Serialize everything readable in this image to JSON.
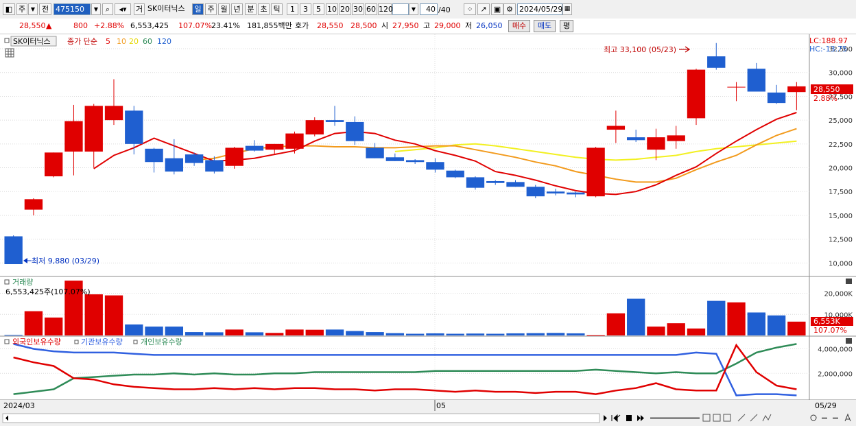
{
  "toolbar": {
    "type_label": "주",
    "prev_label": "전",
    "code": "475150",
    "name_btn": "거",
    "stock_name": "SK이터닉스",
    "periods": [
      "일",
      "주",
      "월",
      "년",
      "분",
      "초",
      "틱"
    ],
    "active_period": "일",
    "intervals": [
      "1",
      "3",
      "5",
      "10",
      "20",
      "30",
      "60",
      "120"
    ],
    "count": "40",
    "count_total": "/40",
    "date": "2024/05/29"
  },
  "quote": {
    "price": "28,550",
    "arrow": "▲",
    "change": "800",
    "change_pct": "+2.88%",
    "volume": "6,553,425",
    "vol_ratio": "107.07%",
    "turnover": "23.41%",
    "amount": "181,855백만",
    "bid_label": "호가",
    "ask": "28,550",
    "bid": "28,500",
    "open_label": "시",
    "open": "27,950",
    "high_label": "고",
    "high": "29,000",
    "low_label": "저",
    "low": "26,050",
    "buy_btn": "매수",
    "sell_btn": "매도",
    "eval_btn": "평"
  },
  "main_panel": {
    "name": "SK이터닉스",
    "ma_title": "종가 단순",
    "ma_periods": [
      "5",
      "10",
      "20",
      "60",
      "120"
    ],
    "lc": "LC:188.97",
    "hc": "HC:-13.75",
    "high_note": "최고 33,100 (05/23)",
    "low_note": "최저 9,880 (03/29)",
    "last_price_tag": "28,550",
    "last_pct_tag": "2.88%",
    "y_ticks": [
      "32,500",
      "30,000",
      "27,500",
      "25,000",
      "22,500",
      "20,000",
      "17,500",
      "15,000",
      "12,500",
      "10,000"
    ]
  },
  "volume_panel": {
    "title": "거래량",
    "value": "6,553,425주(107.07%)",
    "y_ticks": [
      "20,000K",
      "10,000K"
    ],
    "last_tag": "6,553K",
    "last_pct": "107.07%"
  },
  "holding_panel": {
    "legend": [
      "외국인보유수량",
      "기관보유수량",
      "개인보유수량"
    ],
    "y_ticks": [
      "4,000,000",
      "2,000,000"
    ]
  },
  "x_axis": {
    "labels": [
      "2024/03",
      "05",
      "05/29"
    ]
  },
  "colors": {
    "up": "#e00000",
    "down": "#1f5fd0",
    "ma5": "#e00000",
    "ma10": "#f29a1c",
    "ma20": "#f2f020",
    "foreign": "#e00000",
    "institution": "#3060e0",
    "individual": "#2e8b57"
  },
  "chart_data": {
    "type": "candlestick",
    "dates": [
      "03/29",
      "04/01",
      "04/02",
      "04/03",
      "04/04",
      "04/05",
      "04/08",
      "04/09",
      "04/11",
      "04/12",
      "04/15",
      "04/16",
      "04/17",
      "04/18",
      "04/19",
      "04/22",
      "04/23",
      "04/24",
      "04/25",
      "04/26",
      "04/29",
      "04/30",
      "05/02",
      "05/03",
      "05/07",
      "05/08",
      "05/09",
      "05/10",
      "05/13",
      "05/14",
      "05/16",
      "05/17",
      "05/20",
      "05/21",
      "05/22",
      "05/23",
      "05/24",
      "05/27",
      "05/28",
      "05/29"
    ],
    "ohlc": [
      [
        12800,
        12900,
        9880,
        9880
      ],
      [
        15600,
        16800,
        15000,
        16700
      ],
      [
        19100,
        21600,
        19000,
        21600
      ],
      [
        21700,
        26600,
        19200,
        24900
      ],
      [
        21700,
        26700,
        20000,
        26500
      ],
      [
        25000,
        29300,
        24500,
        26500
      ],
      [
        26000,
        26500,
        21400,
        22500
      ],
      [
        22000,
        22100,
        19500,
        20600
      ],
      [
        21000,
        23000,
        19300,
        19600
      ],
      [
        21400,
        21600,
        20200,
        20500
      ],
      [
        20800,
        21200,
        19400,
        19600
      ],
      [
        20200,
        22200,
        19900,
        22100
      ],
      [
        22300,
        22900,
        21700,
        21800
      ],
      [
        21900,
        22500,
        21400,
        22500
      ],
      [
        22000,
        23800,
        21500,
        23600
      ],
      [
        23500,
        25300,
        23300,
        25000
      ],
      [
        25000,
        26500,
        24400,
        24800
      ],
      [
        24800,
        25400,
        22400,
        22800
      ],
      [
        22100,
        22600,
        21000,
        21000
      ],
      [
        21100,
        21500,
        20700,
        20700
      ],
      [
        20800,
        20900,
        20400,
        20600
      ],
      [
        20600,
        21000,
        19500,
        19800
      ],
      [
        19700,
        19800,
        18900,
        19000
      ],
      [
        19000,
        19100,
        17700,
        17900
      ],
      [
        18600,
        18700,
        18200,
        18400
      ],
      [
        18500,
        18700,
        18000,
        18000
      ],
      [
        18000,
        18200,
        16800,
        17000
      ],
      [
        17500,
        17800,
        17100,
        17300
      ],
      [
        17400,
        17500,
        16900,
        17200
      ],
      [
        17000,
        22200,
        16900,
        22100
      ],
      [
        24000,
        26000,
        22600,
        24400
      ],
      [
        23200,
        24000,
        22700,
        22900
      ],
      [
        21900,
        24100,
        20800,
        23200
      ],
      [
        22800,
        24400,
        22000,
        23400
      ],
      [
        25200,
        30400,
        24500,
        30300
      ],
      [
        31700,
        33100,
        30300,
        30500
      ],
      [
        28500,
        29000,
        27000,
        28500
      ],
      [
        30400,
        31000,
        28200,
        28000
      ],
      [
        27900,
        28700,
        26700,
        26800
      ],
      [
        27950,
        29000,
        26050,
        28550
      ]
    ],
    "ma5": [
      null,
      null,
      null,
      null,
      19900,
      21300,
      22100,
      23100,
      22300,
      21500,
      20700,
      20800,
      21000,
      21400,
      21800,
      22800,
      23600,
      23800,
      23600,
      22900,
      22500,
      21800,
      21300,
      20700,
      19600,
      19200,
      18700,
      18100,
      17600,
      17300,
      17200,
      17500,
      18200,
      19200,
      20100,
      21500,
      22800,
      24000,
      25100,
      25800
    ],
    "ma10": [
      null,
      null,
      null,
      null,
      null,
      null,
      null,
      null,
      null,
      20800,
      21000,
      21500,
      22000,
      22200,
      22300,
      22300,
      22200,
      22200,
      22100,
      22100,
      22200,
      22300,
      22300,
      21900,
      21500,
      21100,
      20600,
      20200,
      19600,
      19200,
      18800,
      18500,
      18500,
      18900,
      19800,
      20600,
      21300,
      22400,
      23400,
      24100
    ],
    "ma20": [
      null,
      null,
      null,
      null,
      null,
      null,
      null,
      null,
      null,
      null,
      null,
      null,
      null,
      null,
      null,
      null,
      null,
      null,
      null,
      21700,
      21900,
      22100,
      22400,
      22500,
      22300,
      22000,
      21700,
      21400,
      21100,
      20900,
      20800,
      20900,
      21100,
      21300,
      21700,
      22000,
      22200,
      22400,
      22600,
      22800
    ],
    "volume_k": [
      300,
      11500,
      8500,
      26000,
      19500,
      19000,
      5200,
      4200,
      4200,
      1600,
      1500,
      2800,
      1500,
      1200,
      2800,
      2700,
      2800,
      2100,
      1600,
      1100,
      800,
      1000,
      800,
      900,
      800,
      1000,
      1100,
      1200,
      1000,
      100,
      10500,
      17400,
      4200,
      5800,
      3300,
      16400,
      15700,
      10900,
      9500,
      6553
    ],
    "foreign": [
      3300000,
      2900000,
      2600000,
      1600000,
      1500000,
      1100000,
      900000,
      800000,
      700000,
      700000,
      800000,
      700000,
      800000,
      700000,
      800000,
      800000,
      700000,
      700000,
      600000,
      700000,
      700000,
      600000,
      500000,
      600000,
      500000,
      500000,
      400000,
      500000,
      500000,
      300000,
      600000,
      800000,
      1200000,
      700000,
      600000,
      600000,
      4300000,
      2100000,
      1000000,
      700000
    ],
    "institution": [
      4400000,
      4000000,
      3800000,
      3700000,
      3700000,
      3700000,
      3600000,
      3500000,
      3500000,
      3500000,
      3500000,
      3500000,
      3500000,
      3500000,
      3500000,
      3500000,
      3500000,
      3500000,
      3500000,
      3500000,
      3500000,
      3500000,
      3500000,
      3500000,
      3500000,
      3500000,
      3500000,
      3500000,
      3500000,
      3500000,
      3500000,
      3500000,
      3500000,
      3500000,
      3700000,
      3600000,
      200000,
      300000,
      300000,
      200000
    ],
    "individual": [
      300000,
      500000,
      700000,
      1600000,
      1700000,
      1800000,
      1900000,
      1900000,
      2000000,
      1900000,
      2000000,
      1900000,
      1900000,
      2000000,
      2000000,
      2100000,
      2100000,
      2100000,
      2100000,
      2100000,
      2100000,
      2200000,
      2200000,
      2200000,
      2200000,
      2200000,
      2200000,
      2200000,
      2200000,
      2300000,
      2200000,
      2100000,
      2000000,
      2100000,
      2000000,
      2000000,
      2800000,
      3700000,
      4100000,
      4400000
    ],
    "main_ylim": [
      8800,
      33800
    ],
    "volume_ylim": [
      0,
      27000
    ],
    "holding_ylim": [
      0,
      4700000
    ]
  }
}
